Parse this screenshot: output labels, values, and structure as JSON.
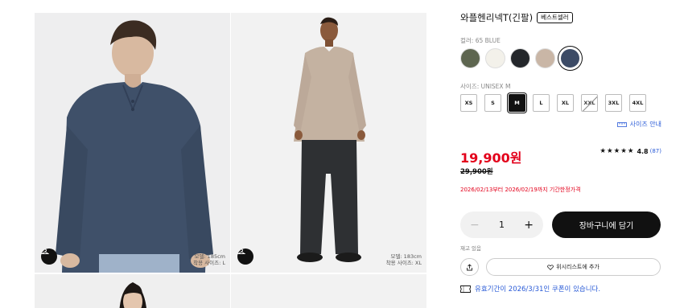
{
  "product": {
    "title": "와플헨리넥T(긴팔)",
    "badge": "베스트셀러",
    "color_label": "컬러: 65 BLUE",
    "colors": [
      {
        "name": "olive",
        "hex": "#5e6650"
      },
      {
        "name": "white",
        "hex": "#f3f1ea"
      },
      {
        "name": "black",
        "hex": "#24272b"
      },
      {
        "name": "beige",
        "hex": "#c9b6a6"
      },
      {
        "name": "blue",
        "hex": "#3c4b66",
        "selected": true
      }
    ],
    "size_label": "사이즈: UNISEX M",
    "sizes": [
      {
        "label": "XS"
      },
      {
        "label": "S"
      },
      {
        "label": "M",
        "selected": true
      },
      {
        "label": "L"
      },
      {
        "label": "XL"
      },
      {
        "label": "XXL",
        "disabled": true
      },
      {
        "label": "3XL"
      },
      {
        "label": "4XL"
      }
    ],
    "size_guide": "사이즈 안내",
    "price": "19,900원",
    "original_price": "29,900원",
    "promo_period": "2026/02/13부터 2026/02/19까지 기간한정가격",
    "rating": {
      "stars": "★★★★★",
      "value": "4.8",
      "count": "(87)"
    },
    "quantity": "1",
    "quantity_minus": "−",
    "quantity_plus": "+",
    "add_to_cart": "장바구니에 담기",
    "stock_status": "재고 있음",
    "wishlist": "위시리스트에 추가",
    "coupon": "유효기간이 2026/3/31인 쿠폰이 있습니다."
  },
  "gallery": {
    "photo1_model": [
      "모델: 185cm",
      "착용 사이즈: L"
    ],
    "photo2_model": [
      "모델: 183cm",
      "착용 사이즈: XL"
    ]
  },
  "colors": {
    "accent_red": "#e3001b",
    "link_blue": "#2a5bd7",
    "button_black": "#111111"
  },
  "icons": [
    "hanger-icon",
    "ruler-icon",
    "share-icon",
    "heart-icon",
    "coupon-icon"
  ]
}
